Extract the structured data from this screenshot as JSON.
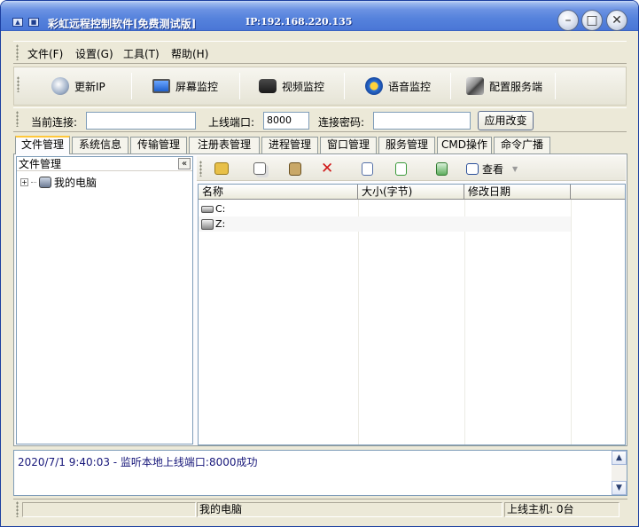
{
  "window": {
    "title": "彩虹远程控制软件[免费测试版]",
    "ip_label": "IP:192.168.220.135"
  },
  "menu": [
    "文件(F)",
    "设置(G)",
    "工具(T)",
    "帮助(H)"
  ],
  "toolbar": {
    "refresh_ip": "更新IP",
    "screen_monitor": "屏幕监控",
    "video_monitor": "视频监控",
    "voice_monitor": "语音监控",
    "config_server": "配置服务端"
  },
  "connection": {
    "current_label": "当前连接:",
    "current_value": "",
    "port_label": "上线端口:",
    "port_value": "8000",
    "password_label": "连接密码:",
    "password_value": "",
    "apply_label": "应用改变"
  },
  "tabs": [
    "文件管理",
    "系统信息",
    "传输管理",
    "注册表管理",
    "进程管理",
    "窗口管理",
    "服务管理",
    "CMD操作",
    "命令广播"
  ],
  "tree": {
    "header": "文件管理",
    "collapse": "«",
    "root_label": "我的电脑"
  },
  "file_toolbar": {
    "view_label": "查看"
  },
  "file_list": {
    "columns": [
      "名称",
      "大小(字节)",
      "修改日期"
    ],
    "rows": [
      {
        "name": "C:"
      },
      {
        "name": "Z:"
      }
    ]
  },
  "log": {
    "lines": [
      "2020/7/1 9:40:03 - 监听本地上线端口:8000成功"
    ]
  },
  "status": {
    "left": "",
    "middle": "我的电脑",
    "right": "上线主机: 0台"
  },
  "colors": {
    "titlebar": "#4a76d6",
    "tab_highlight": "#ffc83c",
    "log_text": "#17177a"
  }
}
